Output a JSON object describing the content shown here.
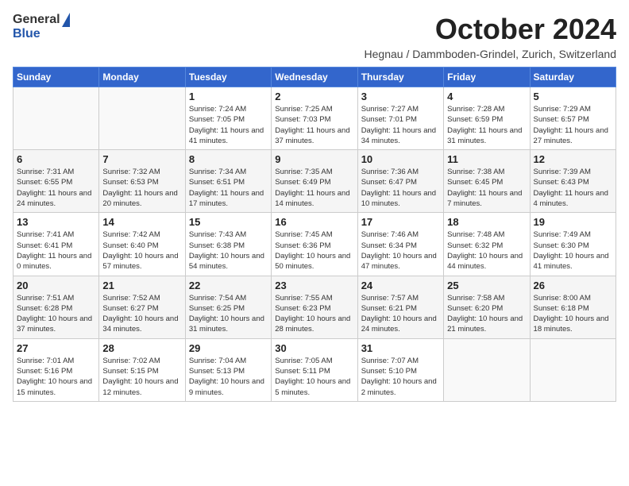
{
  "header": {
    "logo_general": "General",
    "logo_blue": "Blue",
    "month": "October 2024",
    "location": "Hegnau / Dammboden-Grindel, Zurich, Switzerland"
  },
  "weekdays": [
    "Sunday",
    "Monday",
    "Tuesday",
    "Wednesday",
    "Thursday",
    "Friday",
    "Saturday"
  ],
  "weeks": [
    [
      {
        "day": "",
        "info": ""
      },
      {
        "day": "",
        "info": ""
      },
      {
        "day": "1",
        "info": "Sunrise: 7:24 AM\nSunset: 7:05 PM\nDaylight: 11 hours and 41 minutes."
      },
      {
        "day": "2",
        "info": "Sunrise: 7:25 AM\nSunset: 7:03 PM\nDaylight: 11 hours and 37 minutes."
      },
      {
        "day": "3",
        "info": "Sunrise: 7:27 AM\nSunset: 7:01 PM\nDaylight: 11 hours and 34 minutes."
      },
      {
        "day": "4",
        "info": "Sunrise: 7:28 AM\nSunset: 6:59 PM\nDaylight: 11 hours and 31 minutes."
      },
      {
        "day": "5",
        "info": "Sunrise: 7:29 AM\nSunset: 6:57 PM\nDaylight: 11 hours and 27 minutes."
      }
    ],
    [
      {
        "day": "6",
        "info": "Sunrise: 7:31 AM\nSunset: 6:55 PM\nDaylight: 11 hours and 24 minutes."
      },
      {
        "day": "7",
        "info": "Sunrise: 7:32 AM\nSunset: 6:53 PM\nDaylight: 11 hours and 20 minutes."
      },
      {
        "day": "8",
        "info": "Sunrise: 7:34 AM\nSunset: 6:51 PM\nDaylight: 11 hours and 17 minutes."
      },
      {
        "day": "9",
        "info": "Sunrise: 7:35 AM\nSunset: 6:49 PM\nDaylight: 11 hours and 14 minutes."
      },
      {
        "day": "10",
        "info": "Sunrise: 7:36 AM\nSunset: 6:47 PM\nDaylight: 11 hours and 10 minutes."
      },
      {
        "day": "11",
        "info": "Sunrise: 7:38 AM\nSunset: 6:45 PM\nDaylight: 11 hours and 7 minutes."
      },
      {
        "day": "12",
        "info": "Sunrise: 7:39 AM\nSunset: 6:43 PM\nDaylight: 11 hours and 4 minutes."
      }
    ],
    [
      {
        "day": "13",
        "info": "Sunrise: 7:41 AM\nSunset: 6:41 PM\nDaylight: 11 hours and 0 minutes."
      },
      {
        "day": "14",
        "info": "Sunrise: 7:42 AM\nSunset: 6:40 PM\nDaylight: 10 hours and 57 minutes."
      },
      {
        "day": "15",
        "info": "Sunrise: 7:43 AM\nSunset: 6:38 PM\nDaylight: 10 hours and 54 minutes."
      },
      {
        "day": "16",
        "info": "Sunrise: 7:45 AM\nSunset: 6:36 PM\nDaylight: 10 hours and 50 minutes."
      },
      {
        "day": "17",
        "info": "Sunrise: 7:46 AM\nSunset: 6:34 PM\nDaylight: 10 hours and 47 minutes."
      },
      {
        "day": "18",
        "info": "Sunrise: 7:48 AM\nSunset: 6:32 PM\nDaylight: 10 hours and 44 minutes."
      },
      {
        "day": "19",
        "info": "Sunrise: 7:49 AM\nSunset: 6:30 PM\nDaylight: 10 hours and 41 minutes."
      }
    ],
    [
      {
        "day": "20",
        "info": "Sunrise: 7:51 AM\nSunset: 6:28 PM\nDaylight: 10 hours and 37 minutes."
      },
      {
        "day": "21",
        "info": "Sunrise: 7:52 AM\nSunset: 6:27 PM\nDaylight: 10 hours and 34 minutes."
      },
      {
        "day": "22",
        "info": "Sunrise: 7:54 AM\nSunset: 6:25 PM\nDaylight: 10 hours and 31 minutes."
      },
      {
        "day": "23",
        "info": "Sunrise: 7:55 AM\nSunset: 6:23 PM\nDaylight: 10 hours and 28 minutes."
      },
      {
        "day": "24",
        "info": "Sunrise: 7:57 AM\nSunset: 6:21 PM\nDaylight: 10 hours and 24 minutes."
      },
      {
        "day": "25",
        "info": "Sunrise: 7:58 AM\nSunset: 6:20 PM\nDaylight: 10 hours and 21 minutes."
      },
      {
        "day": "26",
        "info": "Sunrise: 8:00 AM\nSunset: 6:18 PM\nDaylight: 10 hours and 18 minutes."
      }
    ],
    [
      {
        "day": "27",
        "info": "Sunrise: 7:01 AM\nSunset: 5:16 PM\nDaylight: 10 hours and 15 minutes."
      },
      {
        "day": "28",
        "info": "Sunrise: 7:02 AM\nSunset: 5:15 PM\nDaylight: 10 hours and 12 minutes."
      },
      {
        "day": "29",
        "info": "Sunrise: 7:04 AM\nSunset: 5:13 PM\nDaylight: 10 hours and 9 minutes."
      },
      {
        "day": "30",
        "info": "Sunrise: 7:05 AM\nSunset: 5:11 PM\nDaylight: 10 hours and 5 minutes."
      },
      {
        "day": "31",
        "info": "Sunrise: 7:07 AM\nSunset: 5:10 PM\nDaylight: 10 hours and 2 minutes."
      },
      {
        "day": "",
        "info": ""
      },
      {
        "day": "",
        "info": ""
      }
    ]
  ]
}
